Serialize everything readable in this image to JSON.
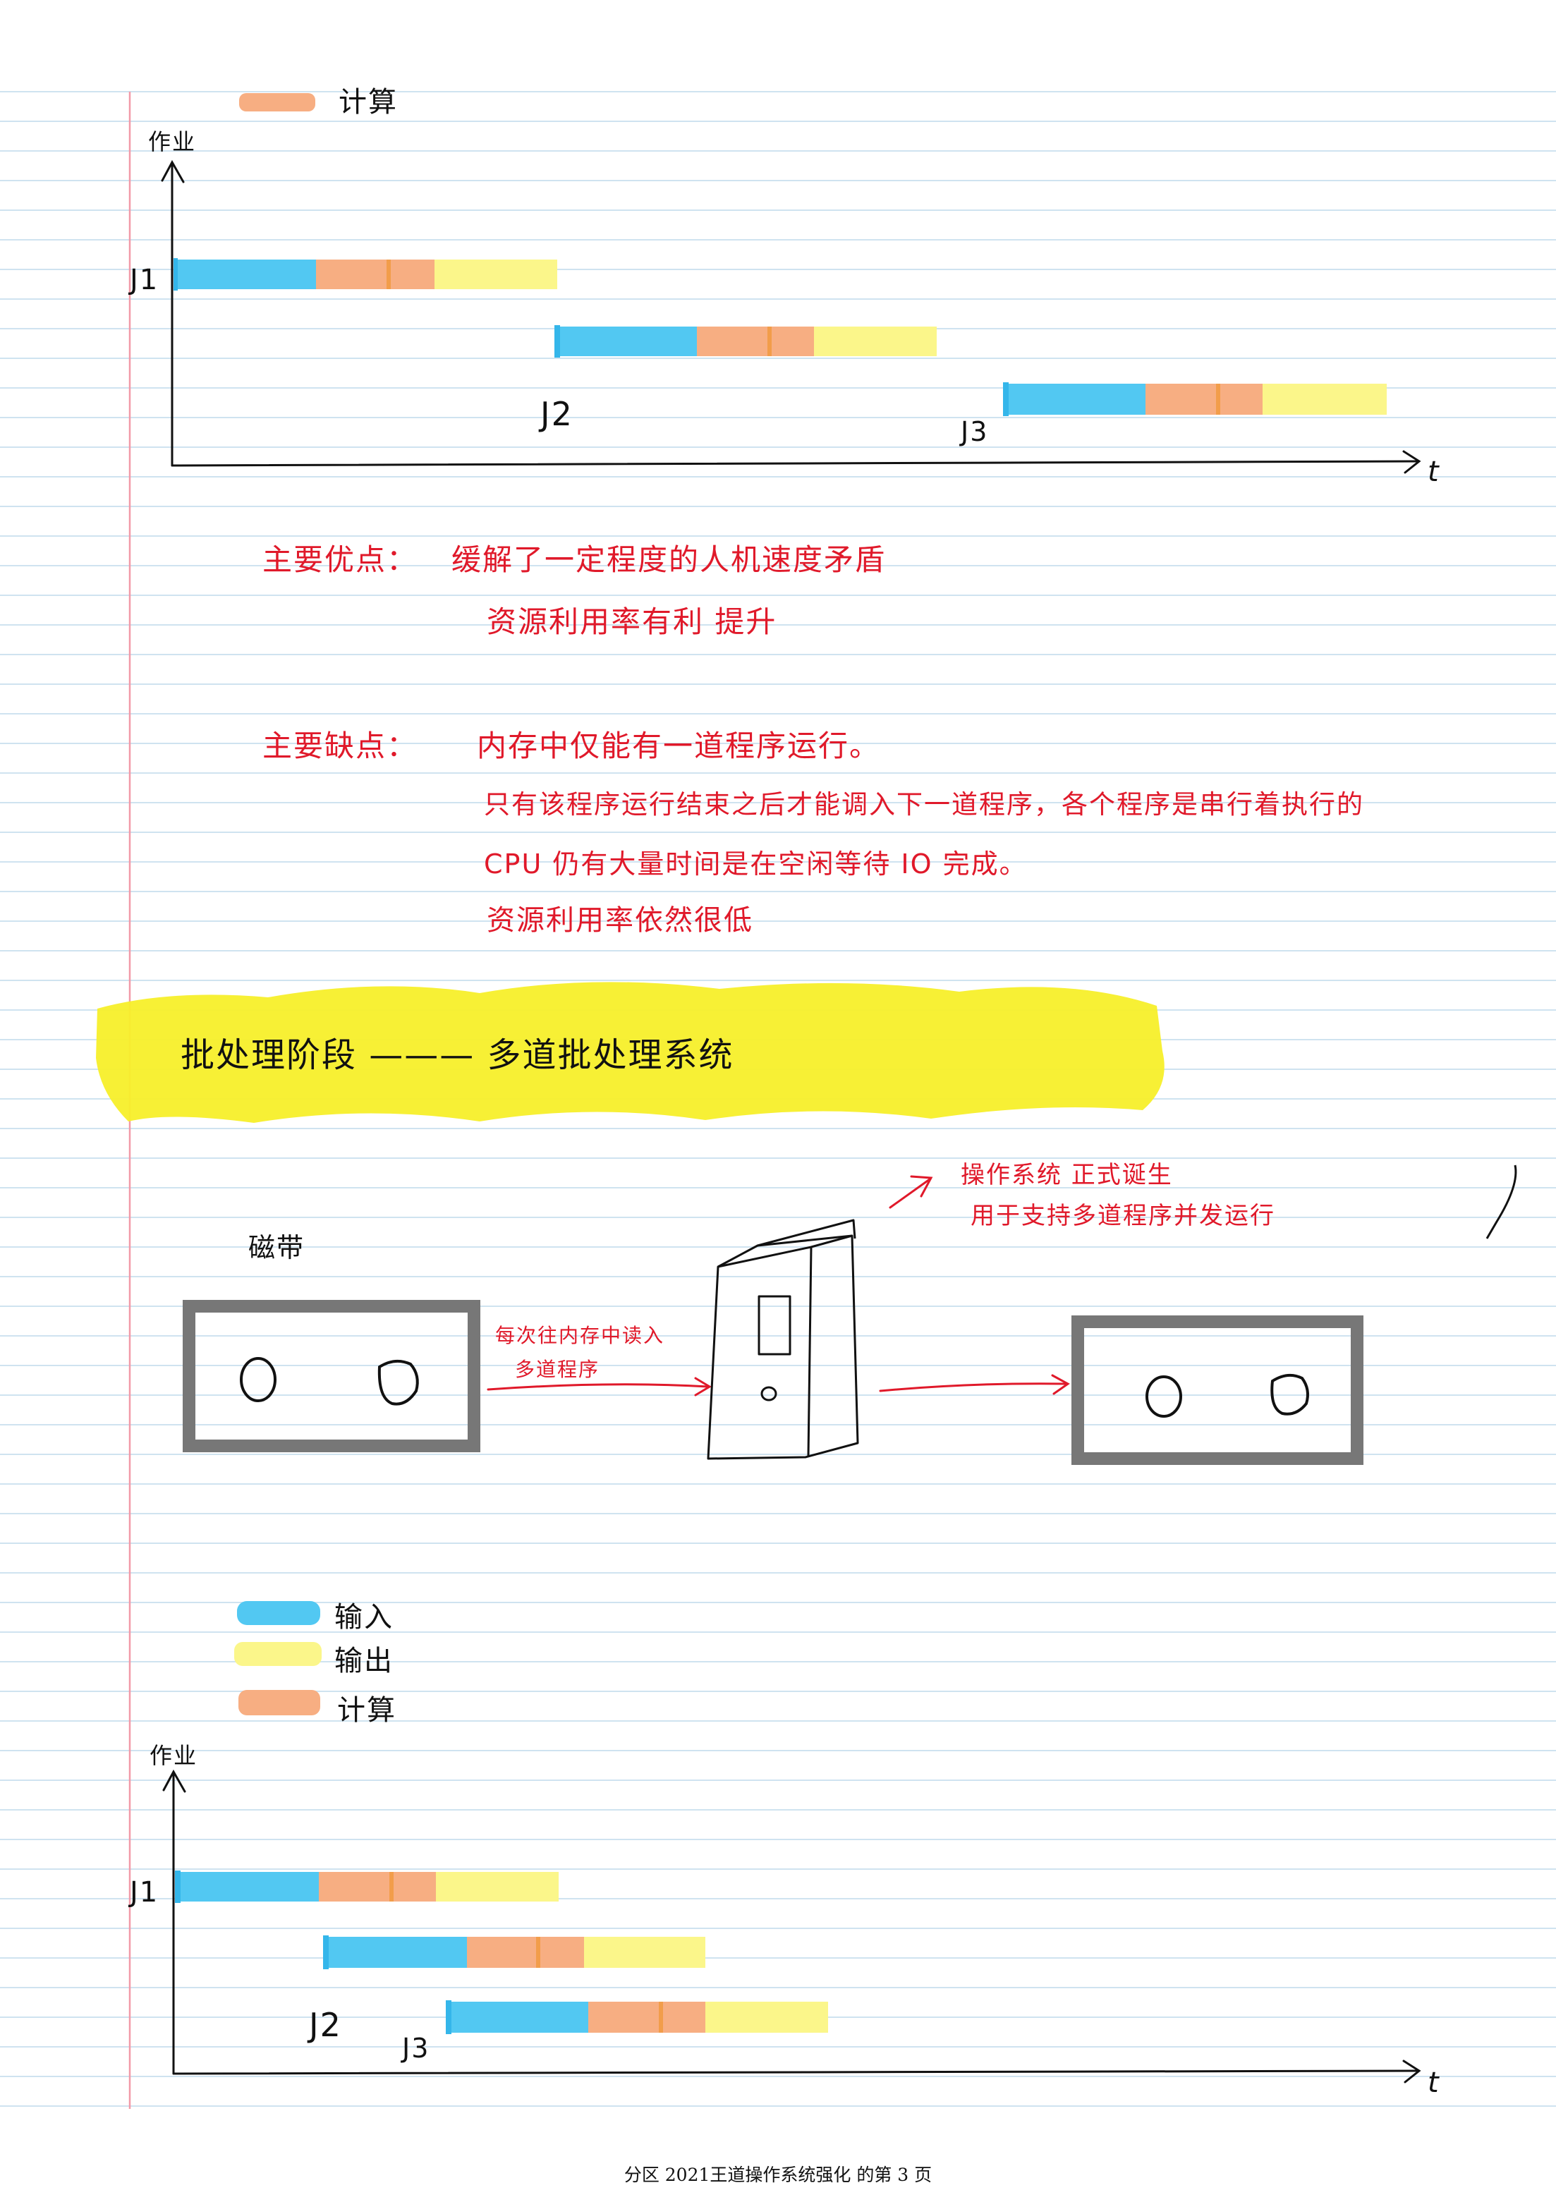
{
  "legend_top": {
    "compute": "计算"
  },
  "chart1": {
    "y_label": "作业",
    "x_label": "t",
    "jobs": [
      "J1",
      "J2",
      "J3"
    ]
  },
  "advantages": {
    "heading": "主要优点：",
    "line1": "缓解了一定程度的人机速度矛盾",
    "line2": "资源利用率有利 提升"
  },
  "disadvantages": {
    "heading": "主要缺点：",
    "line1": "内存中仅能有一道程序运行。",
    "line2": "只有该程序运行结束之后才能调入下一道程序，各个程序是串行着执行的",
    "line3": "CPU 仍有大量时间是在空闲等待 IO 完成。",
    "line4": "资源利用率依然很低"
  },
  "section_title": "批处理阶段 ——— 多道批处理系统",
  "diagram": {
    "tape_label": "磁带",
    "arrow_label_line1": "每次往内存中读入",
    "arrow_label_line2": "多道程序",
    "os_note_line1": "操作系统 正式诞生",
    "os_note_line2": "用于支持多道程序并发运行"
  },
  "legend_bottom": {
    "input": "输入",
    "output": "输出",
    "compute": "计算"
  },
  "chart2": {
    "y_label": "作业",
    "x_label": "t",
    "jobs": [
      "J1",
      "J2",
      "J3"
    ]
  },
  "footer": "分区 2021王道操作系统强化 的第 3 页",
  "colors": {
    "input": "#52c8f2",
    "output": "#fbf68a",
    "compute": "#f7ae82",
    "ink_red": "#e0192a",
    "margin_line": "#f29aa8",
    "rule_line": "#cfe3f0",
    "highlight": "#f7ef2a"
  }
}
